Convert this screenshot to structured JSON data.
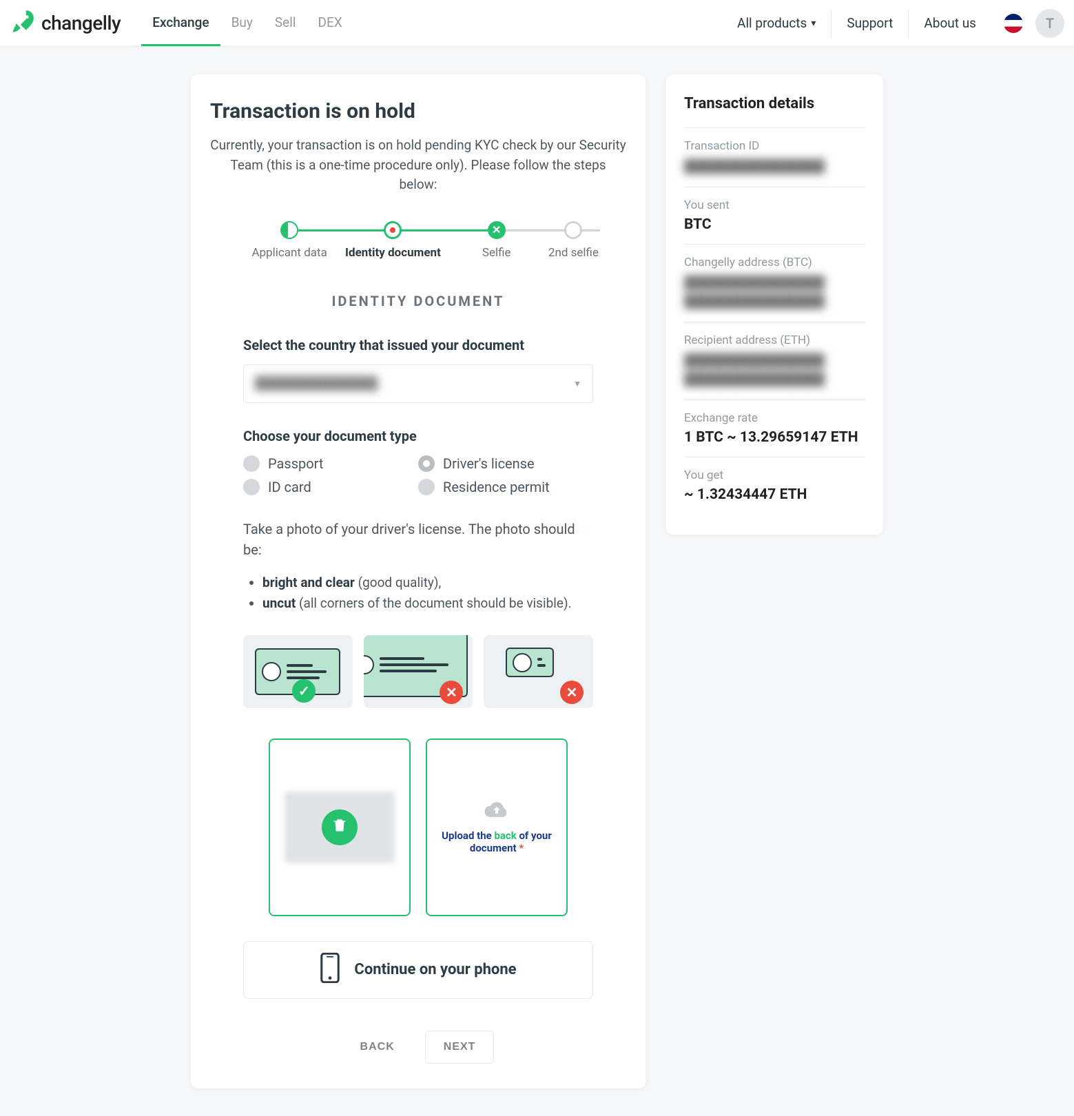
{
  "brand": "changelly",
  "nav": {
    "exchange": "Exchange",
    "buy": "Buy",
    "sell": "Sell",
    "dex": "DEX"
  },
  "header": {
    "all_products": "All products",
    "support": "Support",
    "about": "About us",
    "avatar_initial": "T"
  },
  "main": {
    "title": "Transaction is on hold",
    "description": "Currently, your transaction is on hold pending KYC check by our Security Team (this is a one-time procedure only). Please follow the steps below:",
    "steps": {
      "applicant": "Applicant data",
      "identity": "Identity document",
      "selfie": "Selfie",
      "second_selfie": "2nd selfie"
    },
    "section_heading": "IDENTITY DOCUMENT",
    "country_label": "Select the country that issued your document",
    "country_value": "██████████████",
    "doc_type_label": "Choose your document type",
    "doc_types": {
      "passport": "Passport",
      "drivers": "Driver's license",
      "idcard": "ID card",
      "residence": "Residence permit"
    },
    "photo_instruction": "Take a photo of your driver's license. The photo should be:",
    "rule1_bold": "bright and clear",
    "rule1_rest": " (good quality),",
    "rule2_bold": "uncut",
    "rule2_rest": " (all corners of the document should be visible).",
    "upload_back_pre": "Upload the ",
    "upload_back_hl": "back",
    "upload_back_post": " of your document ",
    "upload_back_req": "*",
    "continue_phone": "Continue on your phone",
    "back_btn": "BACK",
    "next_btn": "NEXT"
  },
  "side": {
    "title": "Transaction details",
    "txid_label": "Transaction ID",
    "txid_value": "████████████████",
    "sent_label": "You sent",
    "sent_value": "BTC",
    "changelly_addr_label": "Changelly address (BTC)",
    "changelly_addr_value": "████████████████\n████████████████",
    "recipient_addr_label": "Recipient address (ETH)",
    "recipient_addr_value": "████████████████\n████████████████",
    "rate_label": "Exchange rate",
    "rate_value": "1 BTC ~ 13.29659147 ETH",
    "get_label": "You get",
    "get_value": "~ 1.32434447 ETH"
  }
}
